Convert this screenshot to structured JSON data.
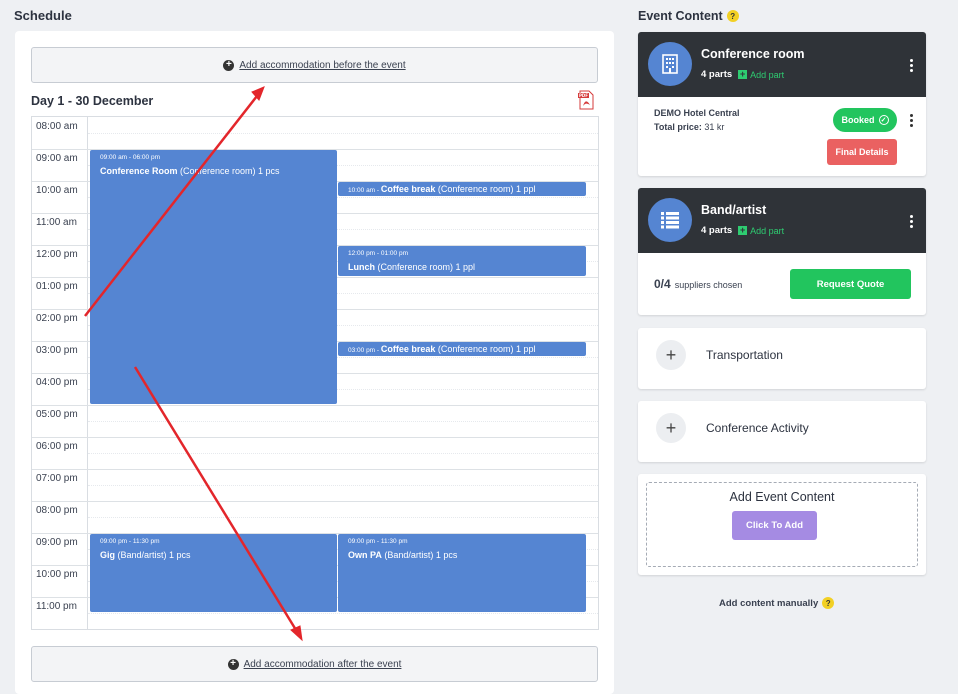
{
  "schedule": {
    "title": "Schedule",
    "add_before": "Add accommodation before the event",
    "add_after": "Add accommodation after the event",
    "day_title": "Day 1 - 30 December",
    "pdf_label": "PDF",
    "times": [
      "08:00 am",
      "09:00 am",
      "10:00 am",
      "11:00 am",
      "12:00 pm",
      "01:00 pm",
      "02:00 pm",
      "03:00 pm",
      "04:00 pm",
      "05:00 pm",
      "06:00 pm",
      "07:00 pm",
      "08:00 pm",
      "09:00 pm",
      "10:00 pm",
      "11:00 pm"
    ],
    "events": {
      "conf_room": {
        "time": "09:00 am - 06:00 pm",
        "name": "Conference Room",
        "detail": " (Conference room) 1 pcs"
      },
      "coffee1": {
        "time": "10:00 am - ",
        "name": "Coffee break",
        "detail": " (Conference room) 1 ppl"
      },
      "lunch": {
        "time": "12:00 pm - 01:00 pm",
        "name": "Lunch",
        "detail": " (Conference room) 1 ppl"
      },
      "coffee2": {
        "time": "03:00 pm - ",
        "name": "Coffee break",
        "detail": " (Conference room) 1 ppl"
      },
      "gig": {
        "time": "09:00 pm - 11:30 pm",
        "name": "Gig",
        "detail": " (Band/artist) 1 pcs"
      },
      "own_pa": {
        "time": "09:00 pm - 11:30 pm",
        "name": "Own PA",
        "detail": " (Band/artist) 1 pcs"
      }
    }
  },
  "event_content": {
    "title": "Event Content",
    "help": "?",
    "conference_room": {
      "name": "Conference room",
      "parts": "4 parts",
      "add_part": "Add part",
      "hotel": "DEMO Hotel Central",
      "total_label": "Total price:",
      "total_value": " 31 kr",
      "booked": "Booked",
      "final_details": "Final Details"
    },
    "band": {
      "name": "Band/artist",
      "parts": "4 parts",
      "add_part": "Add part",
      "suppliers_count": "0/4",
      "suppliers_text": "suppliers chosen",
      "request_quote": "Request Quote"
    },
    "transportation": "Transportation",
    "conference_activity": "Conference Activity",
    "add_event_content": "Add Event Content",
    "click_to_add": "Click To Add",
    "add_manually": "Add content manually"
  },
  "colors": {
    "event_blue": "#5585d2",
    "success": "#22c55e",
    "danger": "#ea6161",
    "accent_purple": "#a58be3",
    "header_dark": "#2f3338",
    "annotation_red": "#e3262b"
  }
}
